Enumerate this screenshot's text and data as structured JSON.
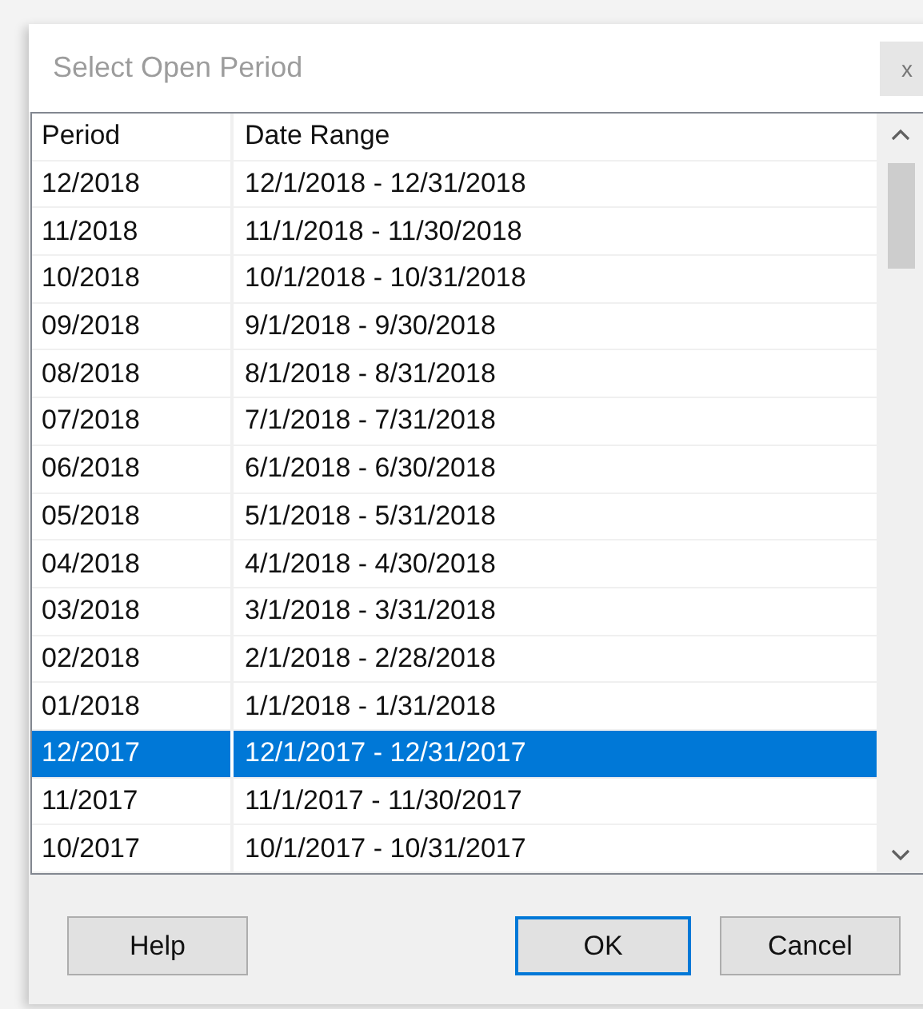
{
  "window": {
    "title": "Select Open Period",
    "close_label": "x"
  },
  "table": {
    "columns": [
      "Period",
      "Date Range"
    ],
    "rows": [
      {
        "period": "12/2018",
        "date_range": "12/1/2018 - 12/31/2018",
        "selected": false
      },
      {
        "period": "11/2018",
        "date_range": "11/1/2018 - 11/30/2018",
        "selected": false
      },
      {
        "period": "10/2018",
        "date_range": "10/1/2018 - 10/31/2018",
        "selected": false
      },
      {
        "period": "09/2018",
        "date_range": "9/1/2018 - 9/30/2018",
        "selected": false
      },
      {
        "period": "08/2018",
        "date_range": "8/1/2018 - 8/31/2018",
        "selected": false
      },
      {
        "period": "07/2018",
        "date_range": "7/1/2018 - 7/31/2018",
        "selected": false
      },
      {
        "period": "06/2018",
        "date_range": "6/1/2018 - 6/30/2018",
        "selected": false
      },
      {
        "period": "05/2018",
        "date_range": "5/1/2018 - 5/31/2018",
        "selected": false
      },
      {
        "period": "04/2018",
        "date_range": "4/1/2018 - 4/30/2018",
        "selected": false
      },
      {
        "period": "03/2018",
        "date_range": "3/1/2018 - 3/31/2018",
        "selected": false
      },
      {
        "period": "02/2018",
        "date_range": "2/1/2018 - 2/28/2018",
        "selected": false
      },
      {
        "period": "01/2018",
        "date_range": "1/1/2018 - 1/31/2018",
        "selected": false
      },
      {
        "period": "12/2017",
        "date_range": "12/1/2017 - 12/31/2017",
        "selected": true
      },
      {
        "period": "11/2017",
        "date_range": "11/1/2017 - 11/30/2017",
        "selected": false
      },
      {
        "period": "10/2017",
        "date_range": "10/1/2017 - 10/31/2017",
        "selected": false
      }
    ]
  },
  "buttons": [
    {
      "label": "Help",
      "default": false
    },
    {
      "label": "OK",
      "default": true
    },
    {
      "label": "Cancel",
      "default": false
    }
  ]
}
